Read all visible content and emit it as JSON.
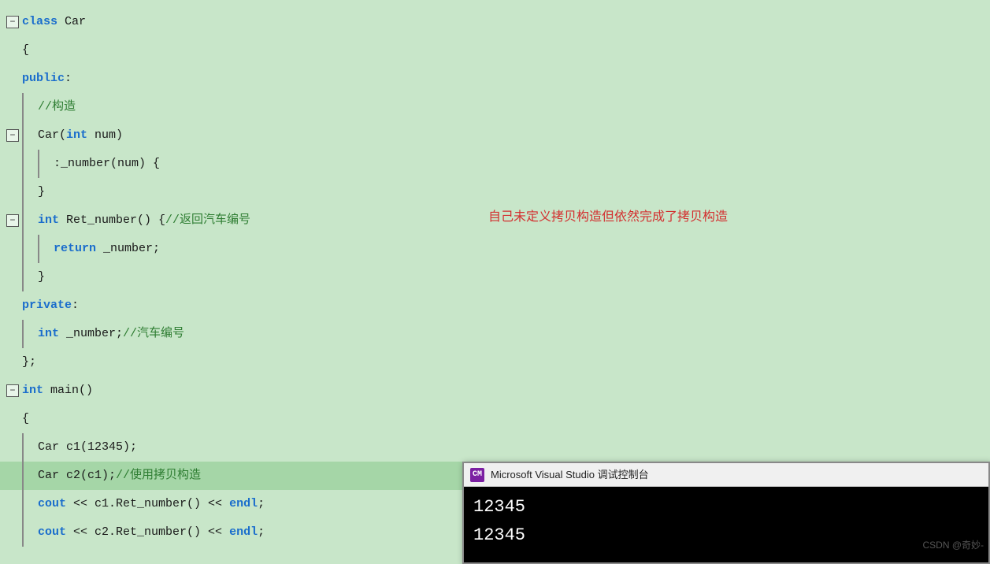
{
  "code": {
    "lines": [
      {
        "id": 1,
        "fold": true,
        "indent": 0,
        "tokens": [
          {
            "t": "kw-class",
            "v": "class "
          },
          {
            "t": "text-dark",
            "v": "Car"
          }
        ]
      },
      {
        "id": 2,
        "indent": 0,
        "tokens": [
          {
            "t": "text-dark",
            "v": "{"
          }
        ]
      },
      {
        "id": 3,
        "indent": 0,
        "tokens": [
          {
            "t": "kw-public",
            "v": "public"
          },
          {
            "t": "text-dark",
            "v": ":"
          }
        ]
      },
      {
        "id": 4,
        "indent": 1,
        "tokens": [
          {
            "t": "comment",
            "v": "//构造"
          }
        ]
      },
      {
        "id": 5,
        "fold": true,
        "indent": 1,
        "tokens": [
          {
            "t": "text-dark",
            "v": "Car("
          },
          {
            "t": "kw-int",
            "v": "int"
          },
          {
            "t": "text-dark",
            "v": " num)"
          }
        ]
      },
      {
        "id": 6,
        "indent": 2,
        "tokens": [
          {
            "t": "text-dark",
            "v": ":_number(num) {"
          }
        ]
      },
      {
        "id": 7,
        "indent": 1,
        "tokens": [
          {
            "t": "text-dark",
            "v": "}"
          }
        ]
      },
      {
        "id": 8,
        "fold": true,
        "indent": 1,
        "tokens": [
          {
            "t": "kw-int",
            "v": "int"
          },
          {
            "t": "text-dark",
            "v": " Ret_number() {"
          },
          {
            "t": "comment",
            "v": "//返回汽车编号"
          }
        ]
      },
      {
        "id": 9,
        "indent": 2,
        "tokens": [
          {
            "t": "kw-return",
            "v": "return"
          },
          {
            "t": "text-dark",
            "v": " _number;"
          }
        ]
      },
      {
        "id": 10,
        "indent": 1,
        "tokens": [
          {
            "t": "text-dark",
            "v": "}"
          }
        ]
      },
      {
        "id": 11,
        "indent": 0,
        "tokens": [
          {
            "t": "kw-private",
            "v": "private"
          },
          {
            "t": "text-dark",
            "v": ":"
          }
        ]
      },
      {
        "id": 12,
        "indent": 1,
        "tokens": [
          {
            "t": "kw-int",
            "v": "int"
          },
          {
            "t": "text-dark",
            "v": " _number;"
          },
          {
            "t": "comment",
            "v": "//汽车编号"
          }
        ]
      },
      {
        "id": 13,
        "indent": 0,
        "tokens": [
          {
            "t": "text-dark",
            "v": "};"
          }
        ]
      },
      {
        "id": 14,
        "fold": true,
        "indent": 0,
        "tokens": [
          {
            "t": "kw-int",
            "v": "int"
          },
          {
            "t": "text-dark",
            "v": " main()"
          }
        ]
      },
      {
        "id": 15,
        "indent": 0,
        "tokens": [
          {
            "t": "text-dark",
            "v": "{"
          }
        ]
      },
      {
        "id": 16,
        "indent": 1,
        "tokens": [
          {
            "t": "text-dark",
            "v": "Car c1(12345);"
          }
        ]
      },
      {
        "id": 17,
        "indent": 1,
        "highlight": true,
        "tokens": [
          {
            "t": "text-dark",
            "v": "Car c2(c1);"
          },
          {
            "t": "comment",
            "v": "//使用拷贝构造"
          }
        ]
      },
      {
        "id": 18,
        "indent": 1,
        "tokens": [
          {
            "t": "kw-cout",
            "v": "cout"
          },
          {
            "t": "text-dark",
            "v": " << c1.Ret_number() << "
          },
          {
            "t": "kw-endl",
            "v": "endl"
          },
          {
            "t": "text-dark",
            "v": ";"
          }
        ]
      },
      {
        "id": 19,
        "indent": 1,
        "tokens": [
          {
            "t": "kw-cout",
            "v": "cout"
          },
          {
            "t": "text-dark",
            "v": " << c2.Ret_number() << "
          },
          {
            "t": "kw-endl",
            "v": "endl"
          },
          {
            "t": "text-dark",
            "v": ";"
          }
        ]
      }
    ]
  },
  "annotation": "自己未定义拷贝构造但依然完成了拷贝构造",
  "console": {
    "title": "Microsoft Visual Studio 调试控制台",
    "icon_label": "CM",
    "output_lines": [
      "12345",
      "12345"
    ]
  },
  "watermark": "CSDN @奇妙-"
}
